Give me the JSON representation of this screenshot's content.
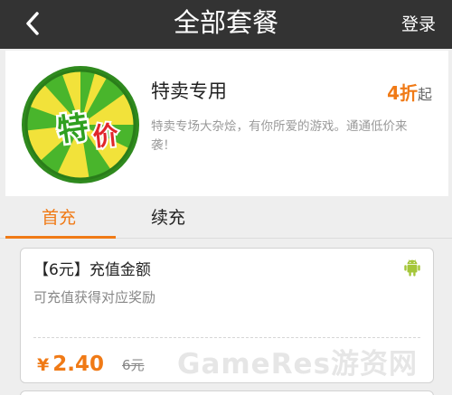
{
  "header": {
    "title": "全部套餐",
    "back_icon": "chevron-left-icon",
    "login_label": "登录"
  },
  "product": {
    "logo_text": "特价",
    "name": "特卖专用",
    "discount_value": "4折",
    "discount_suffix": "起",
    "description": "特卖专场大杂烩，有你所爱的游戏。通通低价来袭！"
  },
  "tabs": [
    {
      "label": "首充",
      "active": true
    },
    {
      "label": "续充",
      "active": false
    }
  ],
  "package": {
    "title": "【6元】充值金额",
    "subtitle": "可充值获得对应奖励",
    "platform_icon": "android-icon",
    "currency_symbol": "¥",
    "price": "2.40",
    "original_price": "6元"
  },
  "watermark": "GameRes游资网",
  "colors": {
    "accent": "#f07a16",
    "header_bg": "#333333",
    "android_green": "#a4c639",
    "logo_green": "#2fa020",
    "logo_yellow": "#f2e23a"
  }
}
